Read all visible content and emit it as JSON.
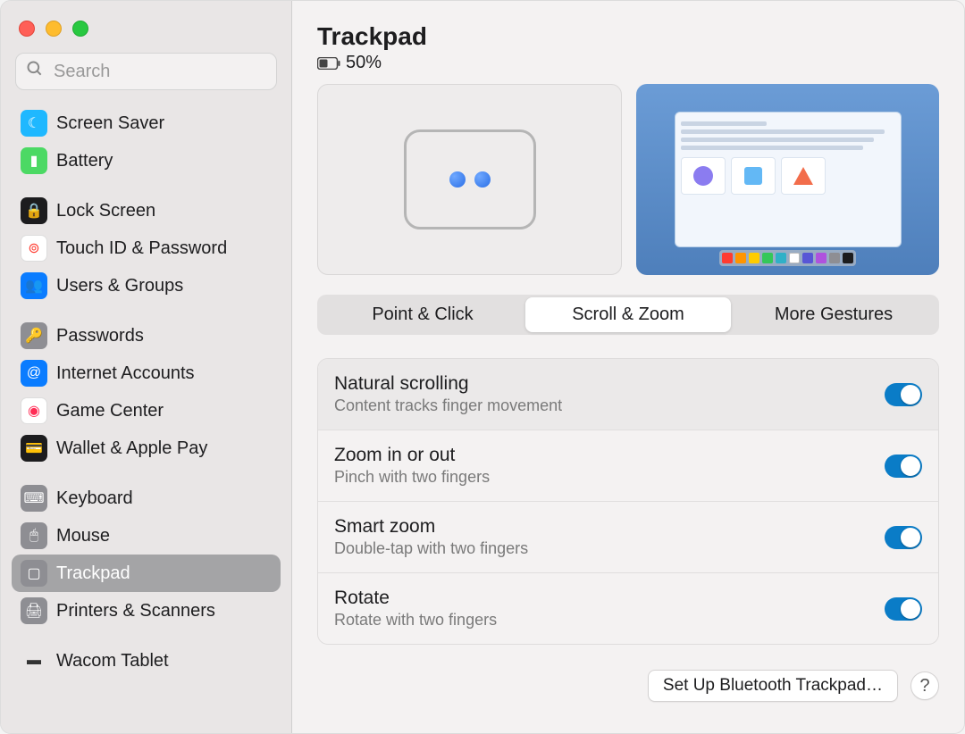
{
  "search": {
    "placeholder": "Search"
  },
  "sidebar": {
    "items": [
      {
        "label": "Screen Saver",
        "icon_bg": "#1fb8ff",
        "glyph": "☾"
      },
      {
        "label": "Battery",
        "icon_bg": "#4cd964",
        "glyph": "▮"
      },
      {
        "label": "Lock Screen",
        "icon_bg": "#1c1c1e",
        "glyph": "🔒"
      },
      {
        "label": "Touch ID & Password",
        "icon_bg": "#ffffff",
        "glyph": "⊚",
        "glyph_color": "#ff3b30",
        "border": "#ddd"
      },
      {
        "label": "Users & Groups",
        "icon_bg": "#0a7cff",
        "glyph": "👥"
      },
      {
        "label": "Passwords",
        "icon_bg": "#8e8e93",
        "glyph": "🔑"
      },
      {
        "label": "Internet Accounts",
        "icon_bg": "#0a7cff",
        "glyph": "@"
      },
      {
        "label": "Game Center",
        "icon_bg": "#ffffff",
        "glyph": "◉",
        "glyph_color": "#ff2d55",
        "border": "#ddd"
      },
      {
        "label": "Wallet & Apple Pay",
        "icon_bg": "#1c1c1e",
        "glyph": "💳"
      },
      {
        "label": "Keyboard",
        "icon_bg": "#8e8e93",
        "glyph": "⌨"
      },
      {
        "label": "Mouse",
        "icon_bg": "#8e8e93",
        "glyph": "🖱"
      },
      {
        "label": "Trackpad",
        "icon_bg": "#8e8e93",
        "glyph": "▢",
        "active": true
      },
      {
        "label": "Printers & Scanners",
        "icon_bg": "#8e8e93",
        "glyph": "🖨"
      },
      {
        "label": "Wacom Tablet",
        "icon_bg": "transparent",
        "glyph": "▬",
        "glyph_color": "#333"
      }
    ]
  },
  "header": {
    "title": "Trackpad",
    "battery": "50%"
  },
  "tabs": {
    "items": [
      "Point & Click",
      "Scroll & Zoom",
      "More Gestures"
    ],
    "active_index": 1
  },
  "settings": [
    {
      "title": "Natural scrolling",
      "desc": "Content tracks finger movement",
      "on": true
    },
    {
      "title": "Zoom in or out",
      "desc": "Pinch with two fingers",
      "on": true
    },
    {
      "title": "Smart zoom",
      "desc": "Double-tap with two fingers",
      "on": true
    },
    {
      "title": "Rotate",
      "desc": "Rotate with two fingers",
      "on": true
    }
  ],
  "footer": {
    "setup_btn": "Set Up Bluetooth Trackpad…",
    "help": "?"
  },
  "dock_colors": [
    "#ff3b30",
    "#ff9500",
    "#ffcc00",
    "#34c759",
    "#30b0c7",
    "#ffffff",
    "#5856d6",
    "#af52de",
    "#8e8e93",
    "#1c1c1e"
  ]
}
